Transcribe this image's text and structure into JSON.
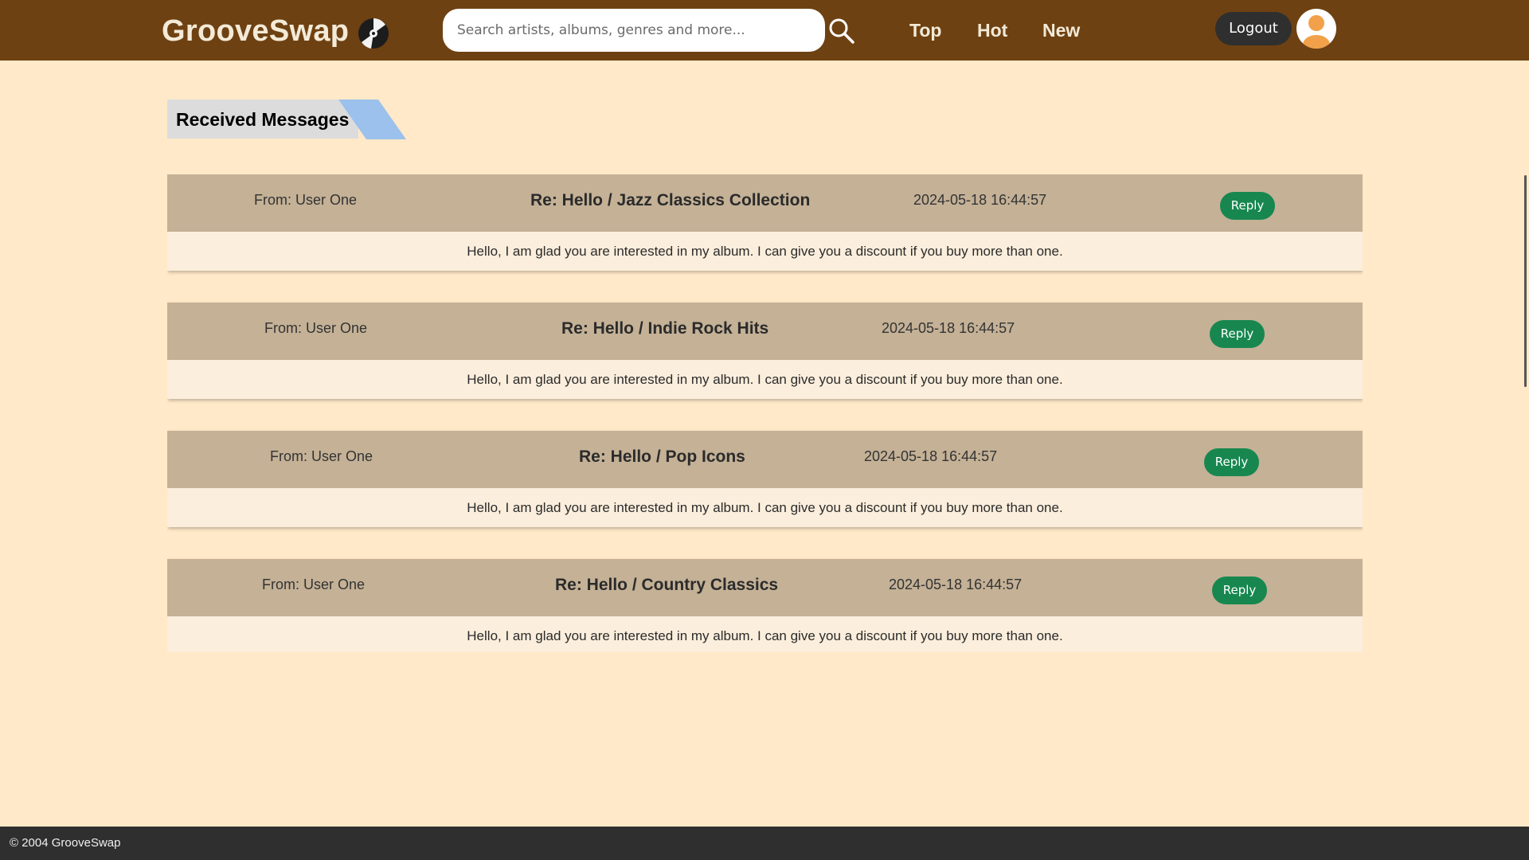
{
  "header": {
    "brand": "GrooveSwap",
    "search_placeholder": "Search artists, albums, genres and more...",
    "nav": [
      "Top",
      "Hot",
      "New"
    ],
    "logout_label": "Logout"
  },
  "page": {
    "section_title": "Received Messages"
  },
  "messages": [
    {
      "from": "From: User One",
      "subject": "Re: Hello / Jazz Classics Collection",
      "date": "2024-05-18 16:44:57",
      "reply_label": "Reply",
      "body": "Hello, I am glad you are interested in my album. I can give you a discount if you buy more than one."
    },
    {
      "from": "From: User One",
      "subject": "Re: Hello / Indie Rock Hits",
      "date": "2024-05-18 16:44:57",
      "reply_label": "Reply",
      "body": "Hello, I am glad you are interested in my album. I can give you a discount if you buy more than one."
    },
    {
      "from": "From: User One",
      "subject": "Re: Hello / Pop Icons",
      "date": "2024-05-18 16:44:57",
      "reply_label": "Reply",
      "body": "Hello, I am glad you are interested in my album. I can give you a discount if you buy more than one."
    },
    {
      "from": "From: User One",
      "subject": "Re: Hello / Country Classics",
      "date": "2024-05-18 16:44:57",
      "reply_label": "Reply",
      "body": "Hello, I am glad you are interested in my album. I can give you a discount if you buy more than one."
    }
  ],
  "footer": {
    "copyright": "© 2004 GrooveSwap"
  },
  "colors": {
    "navbar": "#6e4112",
    "page_background": "#ffe9c8",
    "message_header": "#c4b196",
    "message_body": "#fbeedc",
    "reply_button": "#17874f",
    "title_accent": "#9bc1ec",
    "footer": "#2f2f2f"
  },
  "icons": {
    "brand_logo": "vinyl-record-icon",
    "search": "magnifier-icon",
    "avatar": "user-silhouette-icon"
  }
}
